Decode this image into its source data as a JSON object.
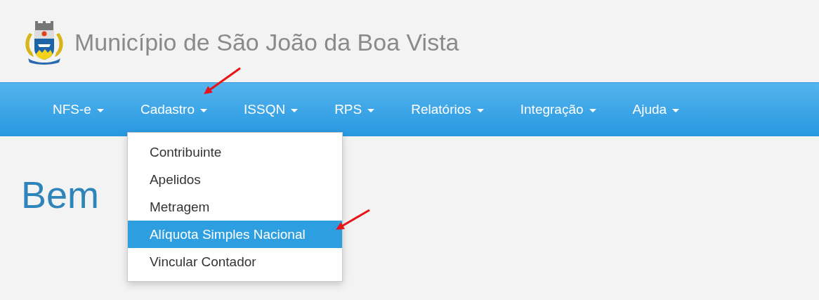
{
  "header": {
    "title": "Município de São João da Boa Vista"
  },
  "nav": {
    "items": [
      {
        "label": "NFS-e"
      },
      {
        "label": "Cadastro",
        "menu": [
          {
            "label": "Contribuinte",
            "selected": false
          },
          {
            "label": "Apelidos",
            "selected": false
          },
          {
            "label": "Metragem",
            "selected": false
          },
          {
            "label": "Alíquota Simples Nacional",
            "selected": true
          },
          {
            "label": "Vincular Contador",
            "selected": false
          }
        ]
      },
      {
        "label": "ISSQN"
      },
      {
        "label": "RPS"
      },
      {
        "label": "Relatórios"
      },
      {
        "label": "Integração"
      },
      {
        "label": "Ajuda"
      }
    ]
  },
  "content": {
    "heading": "Bem"
  }
}
